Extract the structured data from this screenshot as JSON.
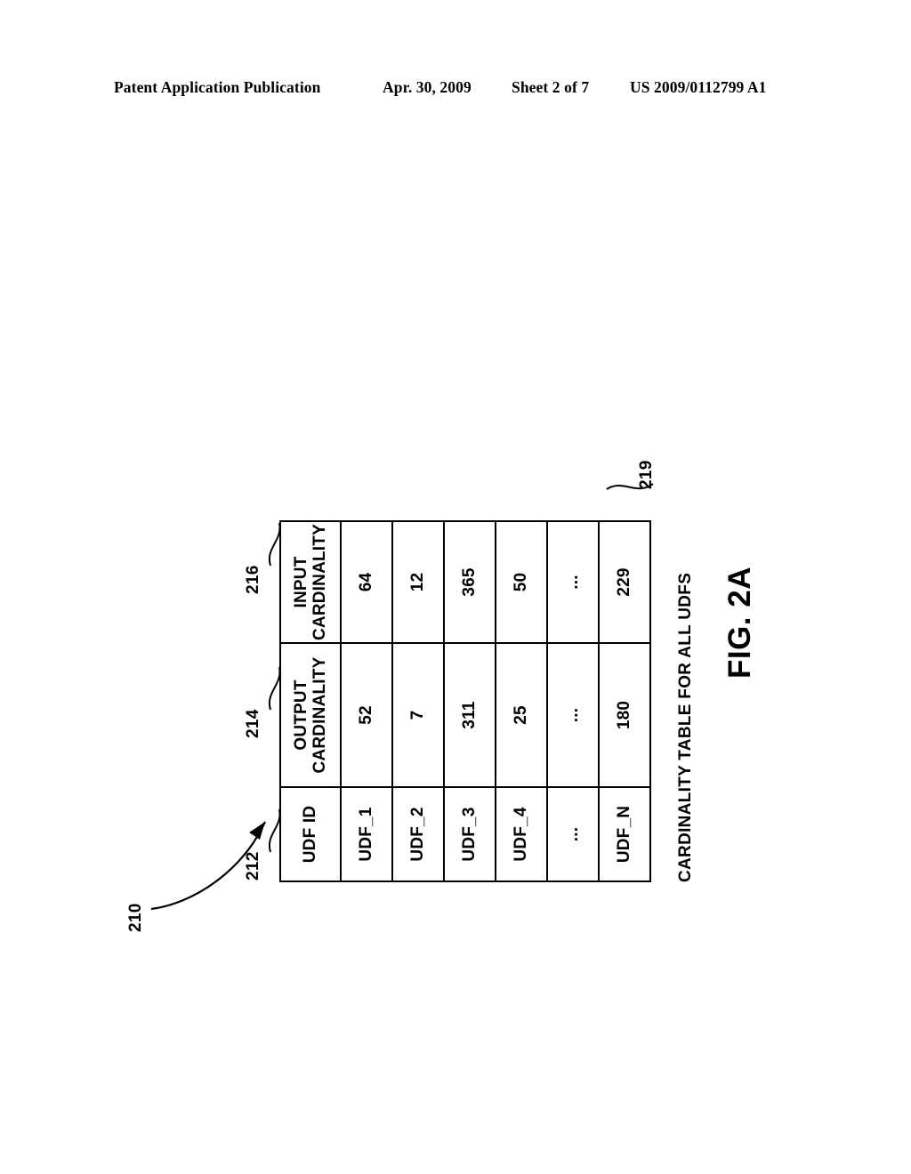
{
  "page_header": {
    "publication": "Patent Application Publication",
    "date": "Apr. 30, 2009",
    "sheet": "Sheet 2 of 7",
    "patent_number": "US 2009/0112799 A1"
  },
  "figure": {
    "label": "FIG. 2A",
    "caption": "CARDINALITY TABLE FOR ALL UDFS",
    "reference_numerals": {
      "figure": "210",
      "udf_id_column": "212",
      "output_cardinality_column": "214",
      "input_cardinality_column": "216",
      "table_body": "219"
    }
  },
  "chart_data": {
    "type": "table",
    "title": "CARDINALITY TABLE FOR ALL UDFS",
    "columns": [
      "UDF ID",
      "OUTPUT CARDINALITY",
      "INPUT CARDINALITY"
    ],
    "column_header_lines": [
      [
        "UDF ID"
      ],
      [
        "OUTPUT",
        "CARDINALITY"
      ],
      [
        "INPUT",
        "CARDINALITY"
      ]
    ],
    "rows": [
      {
        "udf_id": "UDF_1",
        "output_cardinality": "52",
        "input_cardinality": "64"
      },
      {
        "udf_id": "UDF_2",
        "output_cardinality": "7",
        "input_cardinality": "12"
      },
      {
        "udf_id": "UDF_3",
        "output_cardinality": "311",
        "input_cardinality": "365"
      },
      {
        "udf_id": "UDF_4",
        "output_cardinality": "25",
        "input_cardinality": "50"
      },
      {
        "udf_id": "...",
        "output_cardinality": "...",
        "input_cardinality": "..."
      },
      {
        "udf_id": "UDF_N",
        "output_cardinality": "180",
        "input_cardinality": "229"
      }
    ]
  }
}
